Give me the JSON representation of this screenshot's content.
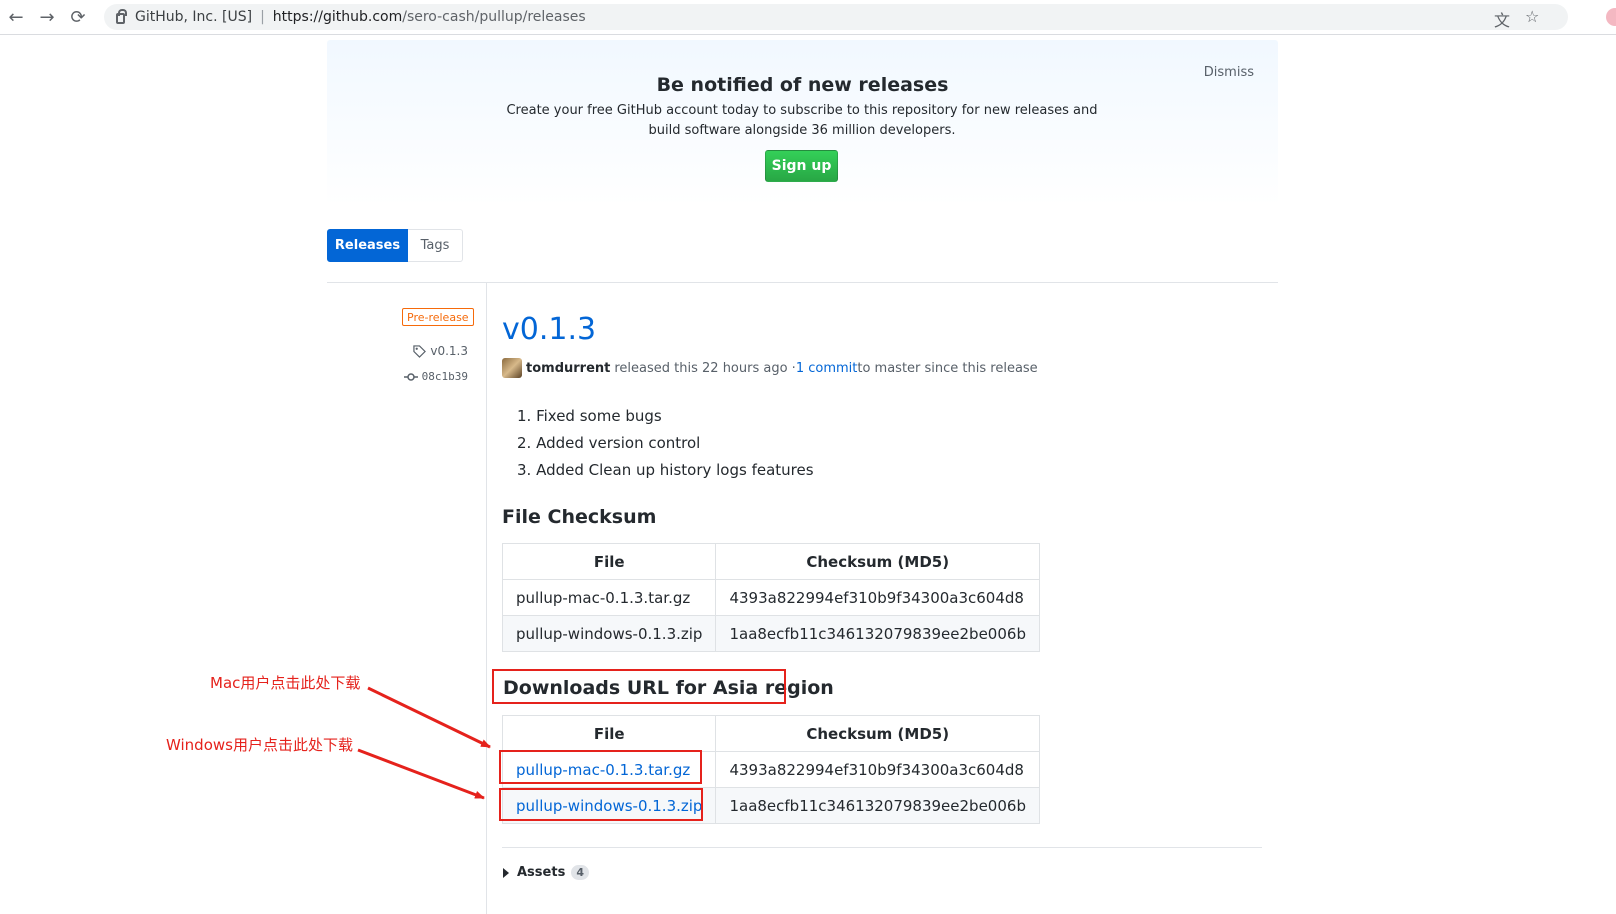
{
  "browser": {
    "back_icon": "←",
    "forward_icon": "→",
    "reload_icon": "⟳",
    "org": "GitHub, Inc. [US]",
    "url_host": "https://github.com",
    "url_path": "/sero-cash/pullup/releases",
    "translate_icon": "文",
    "star_icon": "☆"
  },
  "banner": {
    "title": "Be notified of new releases",
    "text": "Create your free GitHub account today to subscribe to this repository for new releases and build software alongside 36 million developers.",
    "dismiss": "Dismiss",
    "signup": "Sign up"
  },
  "tabs": {
    "releases": "Releases",
    "tags": "Tags"
  },
  "release": {
    "badge": "Pre-release",
    "tag": "v0.1.3",
    "commit": "08c1b39",
    "version": "v0.1.3",
    "author": "tomdurrent",
    "released_text": "released this 22 hours ago · ",
    "commit_link": "1 commit",
    "since_text": " to master since this release",
    "notes": [
      "1. Fixed some bugs",
      "2. Added version control",
      "3. Added Clean up history logs features"
    ],
    "checksum_heading": "File Checksum",
    "downloads_heading": "Downloads URL for Asia region",
    "table_header_file": "File",
    "table_header_sum": "Checksum (MD5)",
    "checksum_rows": [
      {
        "file": "pullup-mac-0.1.3.tar.gz",
        "md5": "4393a822994ef310b9f34300a3c604d8"
      },
      {
        "file": "pullup-windows-0.1.3.zip",
        "md5": "1aa8ecfb11c346132079839ee2be006b"
      }
    ],
    "download_rows": [
      {
        "file": "pullup-mac-0.1.3.tar.gz",
        "md5": "4393a822994ef310b9f34300a3c604d8"
      },
      {
        "file": "pullup-windows-0.1.3.zip",
        "md5": "1aa8ecfb11c346132079839ee2be006b"
      }
    ],
    "assets_label": "Assets",
    "assets_count": "4"
  },
  "annotations": {
    "mac_label": "Mac用户点击此处下载",
    "windows_label": "Windows用户点击此处下载",
    "color": "#e5221c"
  }
}
